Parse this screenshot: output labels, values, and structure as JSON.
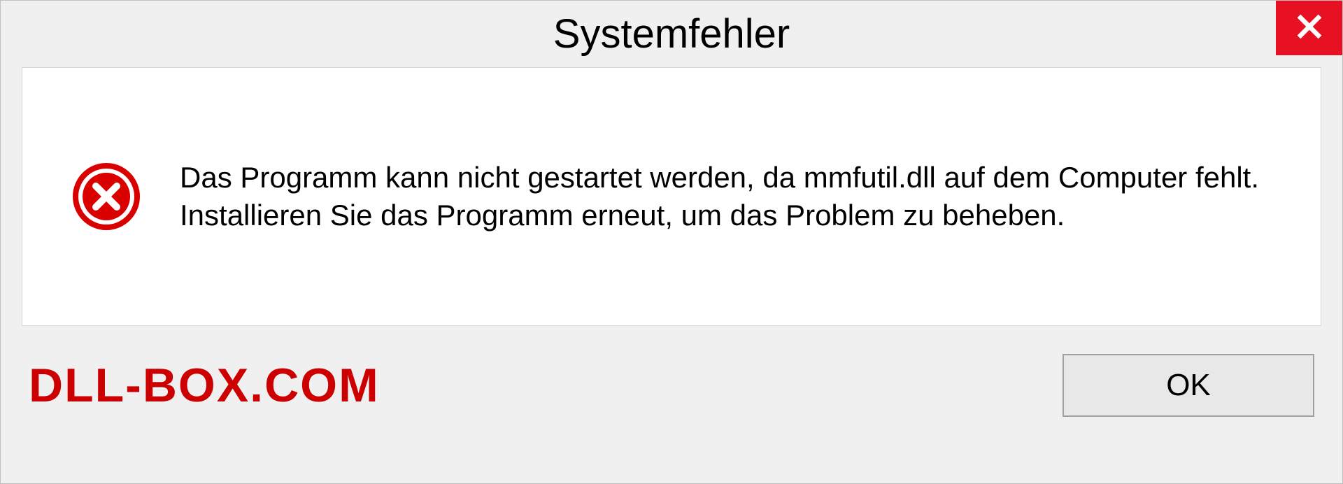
{
  "dialog": {
    "title": "Systemfehler",
    "message": "Das Programm kann nicht gestartet werden, da mmfutil.dll auf dem Computer fehlt. Installieren Sie das Programm erneut, um das Problem zu beheben.",
    "ok_label": "OK"
  },
  "watermark": "DLL-BOX.COM"
}
